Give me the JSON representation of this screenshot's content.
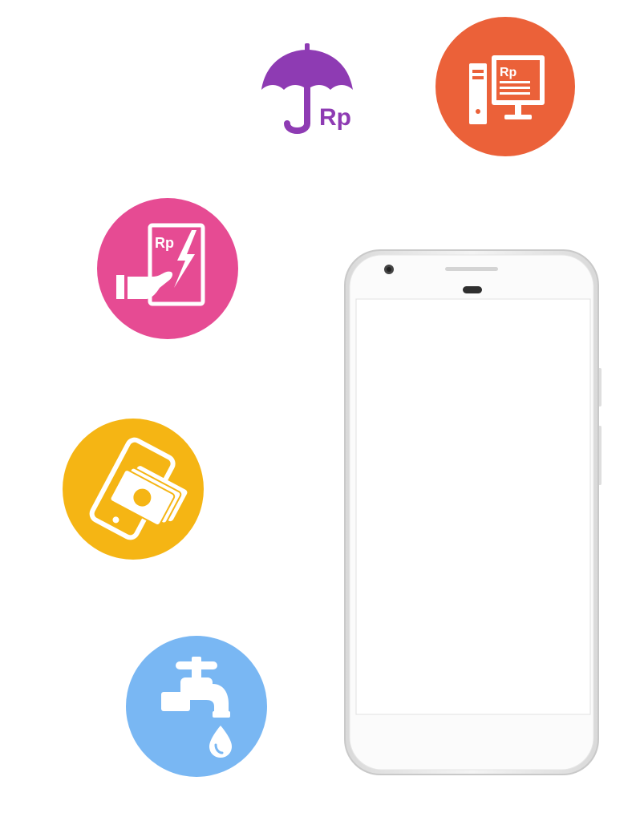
{
  "colors": {
    "insurance": "#8e3bb3",
    "internet": "#eb6139",
    "electricity": "#e64b93",
    "mobile": "#f5b514",
    "water": "#79b7f3",
    "phone_body": "#ffffff",
    "phone_edge": "#cfcfcf"
  },
  "icons": {
    "insurance": {
      "name": "umbrella-rupiah-icon",
      "text": "Rp"
    },
    "internet": {
      "name": "computer-rupiah-icon",
      "text": "Rp"
    },
    "electricity": {
      "name": "electric-bill-icon",
      "text": "Rp"
    },
    "mobile": {
      "name": "mobile-credit-icon"
    },
    "water": {
      "name": "water-tap-icon"
    }
  }
}
